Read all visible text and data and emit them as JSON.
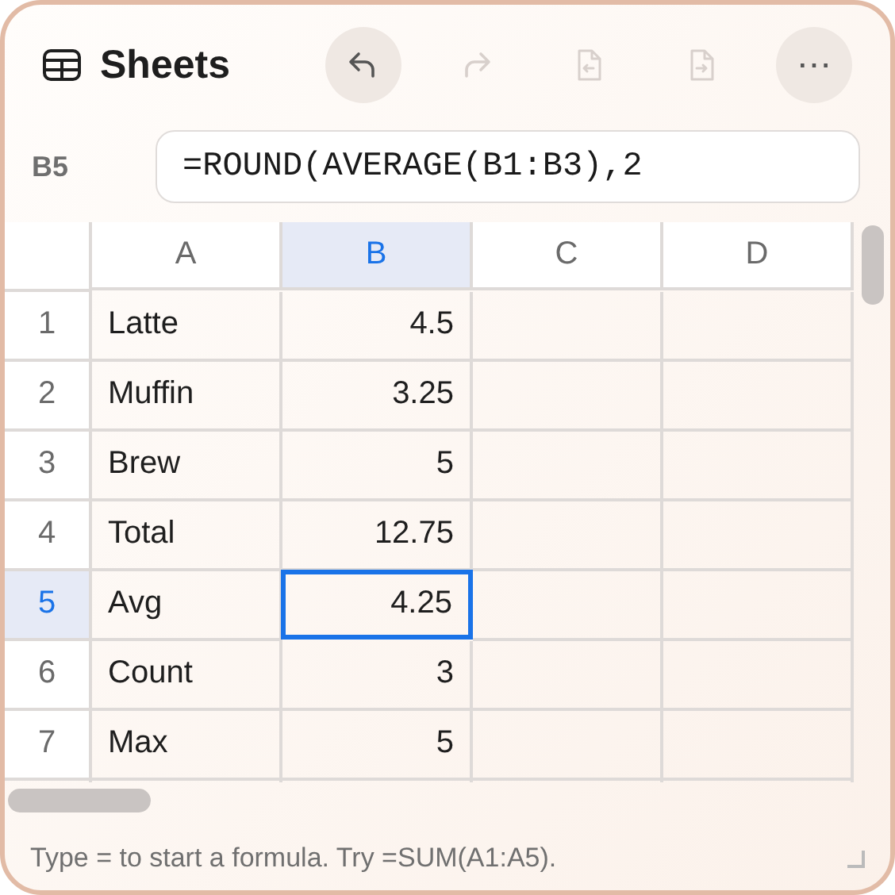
{
  "window": {
    "title": "Sheets"
  },
  "toolbar": [
    {
      "kind": "undo",
      "disabled": false
    },
    {
      "kind": "redo",
      "disabled": true
    },
    {
      "kind": "import",
      "disabled": true
    },
    {
      "kind": "export",
      "disabled": true
    },
    {
      "kind": "more",
      "label": "⋯",
      "disabled": false
    }
  ],
  "formula_bar": {
    "cell_ref": "B5",
    "value": "=ROUND(AVERAGE(B1:B3),2"
  },
  "columns": [
    {
      "label": "A",
      "selected": false
    },
    {
      "label": "B",
      "selected": true
    },
    {
      "label": "C",
      "selected": false
    },
    {
      "label": "D",
      "selected": false
    }
  ],
  "rows": [
    {
      "label": "1",
      "selected": false,
      "cells": [
        {
          "value": "Latte",
          "selected": false
        },
        {
          "value": "4.5",
          "selected": false
        },
        {
          "selected": false
        },
        {
          "selected": false
        }
      ]
    },
    {
      "label": "2",
      "selected": false,
      "cells": [
        {
          "value": "Muffin",
          "selected": false
        },
        {
          "value": "3.25",
          "selected": false
        },
        {
          "selected": false
        },
        {
          "selected": false
        }
      ]
    },
    {
      "label": "3",
      "selected": false,
      "cells": [
        {
          "value": "Brew",
          "selected": false
        },
        {
          "value": "5",
          "selected": false
        },
        {
          "selected": false
        },
        {
          "selected": false
        }
      ]
    },
    {
      "label": "4",
      "selected": false,
      "cells": [
        {
          "value": "Total",
          "selected": false
        },
        {
          "value": "12.75",
          "selected": false
        },
        {
          "selected": false
        },
        {
          "selected": false
        }
      ]
    },
    {
      "label": "5",
      "selected": true,
      "cells": [
        {
          "value": "Avg",
          "selected": false
        },
        {
          "value": "4.25",
          "selected": true
        },
        {
          "selected": false
        },
        {
          "selected": false
        }
      ]
    },
    {
      "label": "6",
      "selected": false,
      "cells": [
        {
          "value": "Count",
          "selected": false
        },
        {
          "value": "3",
          "selected": false
        },
        {
          "selected": false
        },
        {
          "selected": false
        }
      ]
    },
    {
      "label": "7",
      "selected": false,
      "cells": [
        {
          "value": "Max",
          "selected": false
        },
        {
          "value": "5",
          "selected": false
        },
        {
          "selected": false
        },
        {
          "selected": false
        }
      ]
    }
  ],
  "status_bar": {
    "text": "Type = to start a formula. Try =SUM(A1:A5)."
  }
}
